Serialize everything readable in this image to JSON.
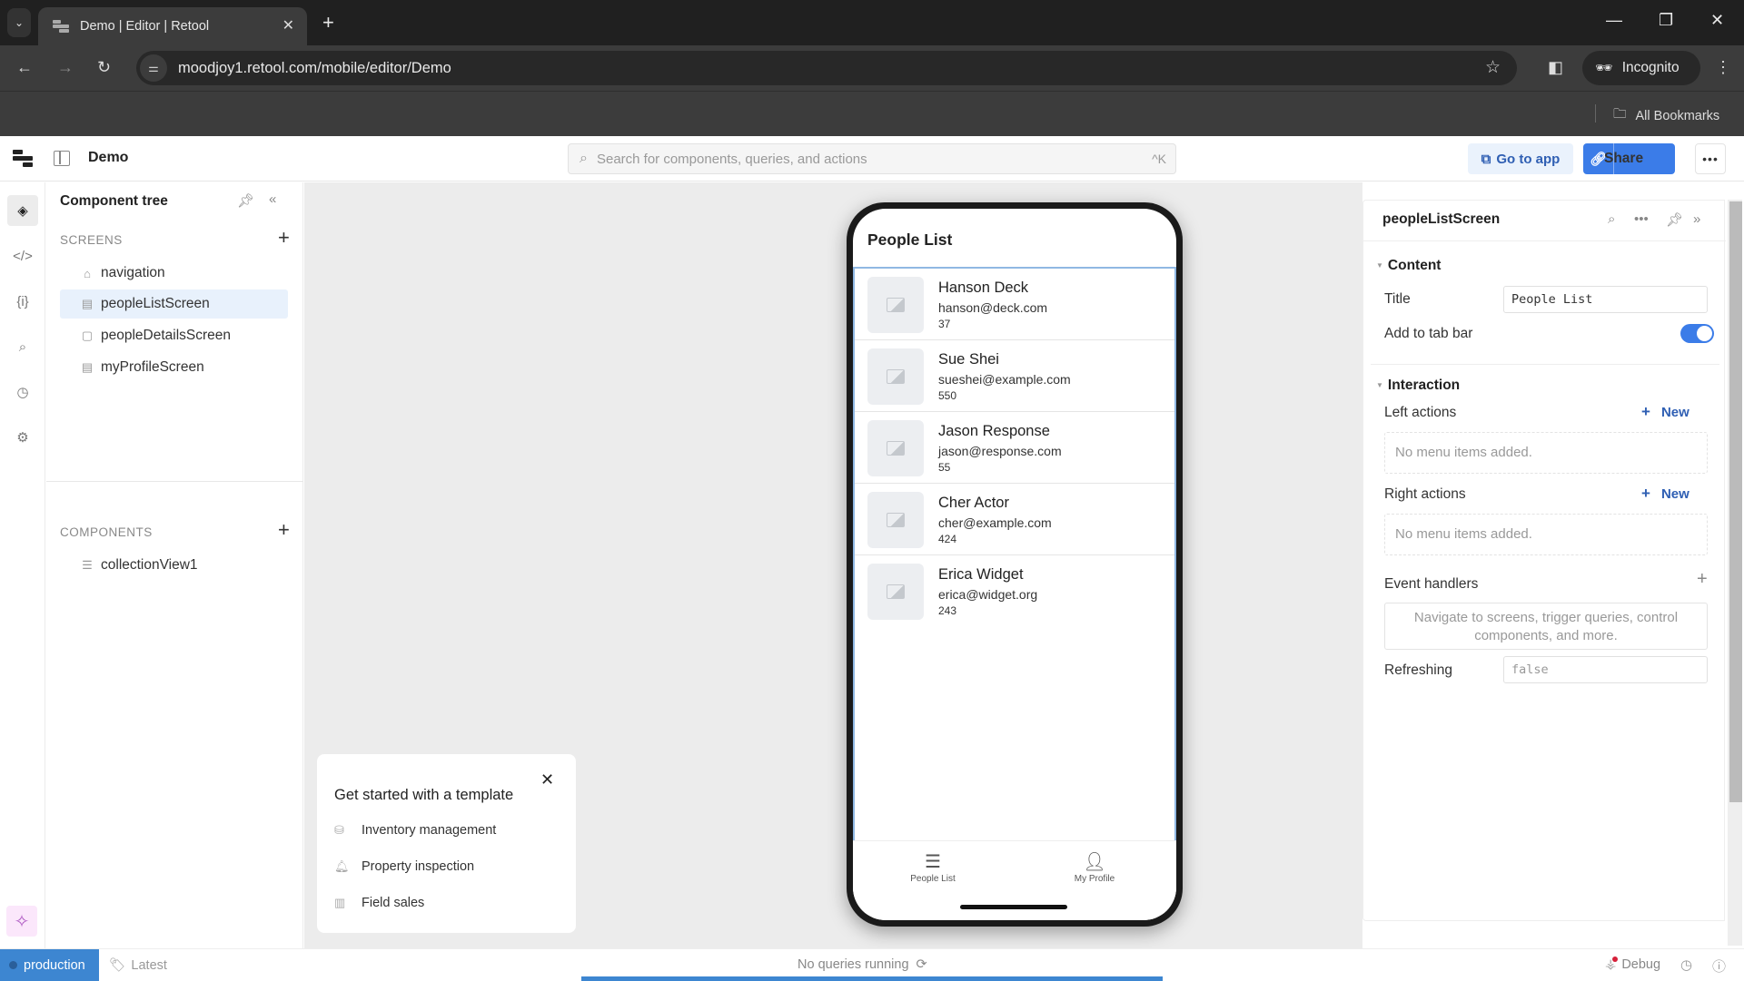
{
  "browser": {
    "tab_title": "Demo | Editor | Retool",
    "url": "moodjoy1.retool.com/mobile/editor/Demo",
    "incognito_label": "Incognito",
    "bookmarks_label": "All Bookmarks"
  },
  "header": {
    "app_name": "Demo",
    "search_placeholder": "Search for components, queries, and actions",
    "search_shortcut": "^K",
    "go_to_app_label": "Go to app",
    "share_label": "Share"
  },
  "component_tree": {
    "title": "Component tree",
    "screens_label": "SCREENS",
    "screens": [
      {
        "label": "navigation",
        "icon": "home-icon"
      },
      {
        "label": "peopleListScreen",
        "icon": "screen-home-icon",
        "selected": true
      },
      {
        "label": "peopleDetailsScreen",
        "icon": "screen-icon"
      },
      {
        "label": "myProfileScreen",
        "icon": "screen-home-icon"
      }
    ],
    "components_label": "COMPONENTS",
    "components": [
      {
        "label": "collectionView1",
        "icon": "list-icon"
      }
    ]
  },
  "phone": {
    "screen_title": "People List",
    "people": [
      {
        "name": "Hanson Deck",
        "email": "hanson@deck.com",
        "value": "37"
      },
      {
        "name": "Sue Shei",
        "email": "sueshei@example.com",
        "value": "550"
      },
      {
        "name": "Jason Response",
        "email": "jason@response.com",
        "value": "55"
      },
      {
        "name": "Cher Actor",
        "email": "cher@example.com",
        "value": "424"
      },
      {
        "name": "Erica Widget",
        "email": "erica@widget.org",
        "value": "243"
      }
    ],
    "tabs": [
      {
        "label": "People List",
        "icon": "list-icon"
      },
      {
        "label": "My Profile",
        "icon": "person-icon"
      }
    ]
  },
  "template_card": {
    "title": "Get started with a template",
    "items": [
      {
        "label": "Inventory management",
        "icon": "database-icon"
      },
      {
        "label": "Property inspection",
        "icon": "bell-icon"
      },
      {
        "label": "Field sales",
        "icon": "chart-icon"
      }
    ]
  },
  "inspector": {
    "title": "peopleListScreen",
    "content_section": "Content",
    "title_label": "Title",
    "title_value": "People List",
    "tabbar_label": "Add to tab bar",
    "tabbar_enabled": true,
    "interaction_section": "Interaction",
    "left_actions_label": "Left actions",
    "right_actions_label": "Right actions",
    "new_label": "New",
    "empty_menu": "No menu items added.",
    "event_handlers_label": "Event handlers",
    "event_handlers_hint": "Navigate to screens, trigger queries, control components, and more.",
    "refreshing_label": "Refreshing",
    "refreshing_value": "false"
  },
  "statusbar": {
    "environment": "production",
    "version": "Latest",
    "queries_status": "No queries running",
    "debug_label": "Debug"
  }
}
